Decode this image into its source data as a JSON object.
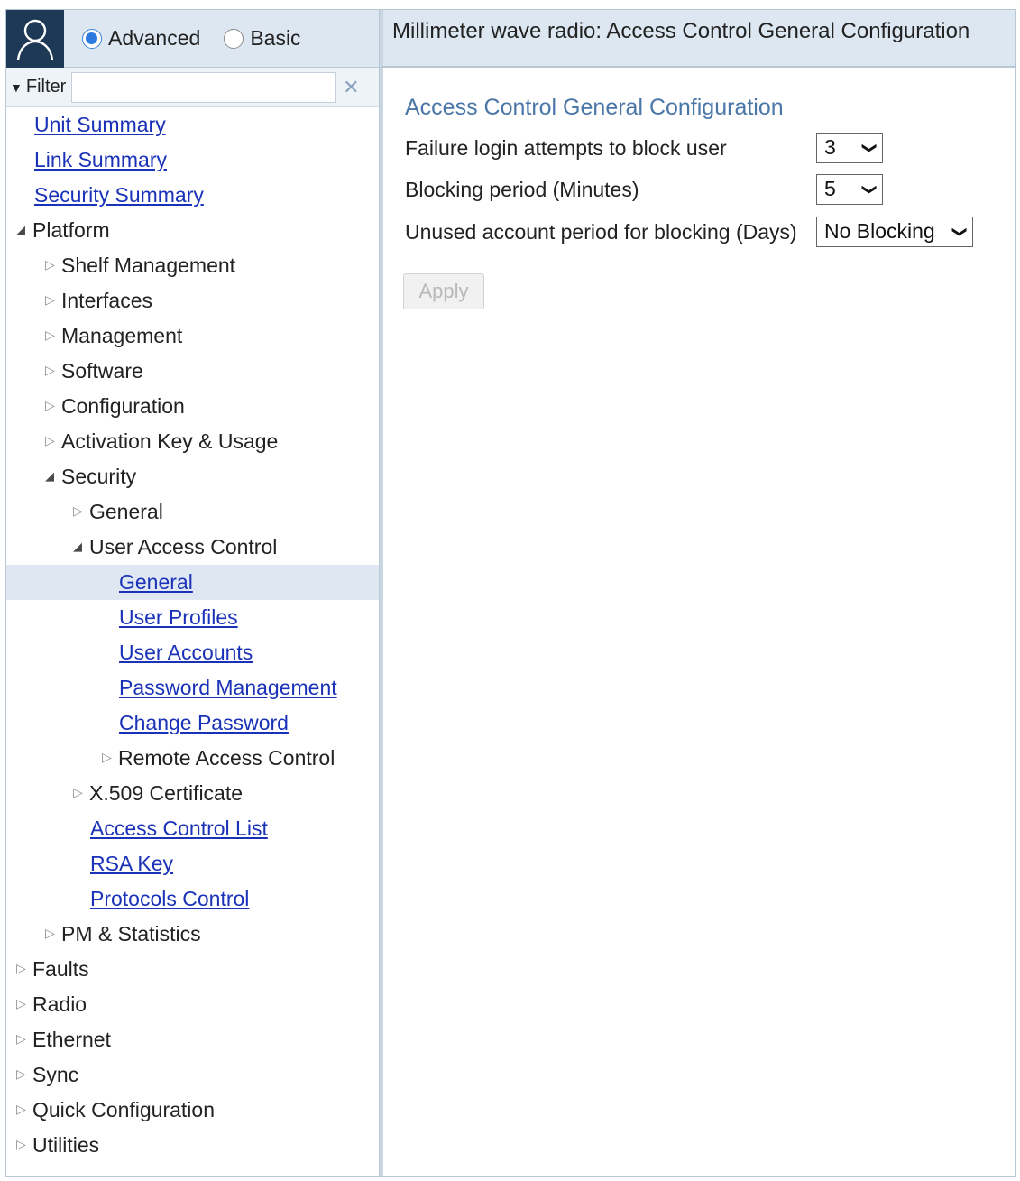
{
  "header": {
    "mode_options": [
      {
        "label": "Advanced",
        "selected": true
      },
      {
        "label": "Basic",
        "selected": false
      }
    ],
    "filter_label": "Filter",
    "filter_value": ""
  },
  "nav": {
    "unit_summary": "Unit Summary",
    "link_summary": "Link Summary",
    "security_summary": "Security Summary",
    "platform": "Platform",
    "shelf_management": "Shelf Management",
    "interfaces": "Interfaces",
    "management": "Management",
    "software": "Software",
    "configuration": "Configuration",
    "activation_key": "Activation Key & Usage",
    "security": "Security",
    "general": "General",
    "user_access_control": "User Access Control",
    "uac_general": "General",
    "user_profiles": "User Profiles",
    "user_accounts": "User Accounts",
    "password_management": "Password Management",
    "change_password": "Change Password",
    "remote_access_control": "Remote Access Control",
    "x509": "X.509 Certificate",
    "access_control_list": "Access Control List",
    "rsa_key": "RSA Key",
    "protocols_control": "Protocols Control",
    "pm_statistics": "PM & Statistics",
    "faults": "Faults",
    "radio": "Radio",
    "ethernet": "Ethernet",
    "sync": "Sync",
    "quick_configuration": "Quick Configuration",
    "utilities": "Utilities"
  },
  "main": {
    "page_title": "Millimeter wave radio: Access Control General Configuration",
    "section_title": "Access Control General Configuration",
    "failure_login_label": "Failure login attempts to block user",
    "failure_login_value": "3",
    "blocking_period_label": "Blocking period (Minutes)",
    "blocking_period_value": "5",
    "unused_account_label": "Unused account period for blocking (Days)",
    "unused_account_value": "No Blocking",
    "apply_label": "Apply"
  },
  "colors": {
    "header_bg": "#dde7f1",
    "avatar_bg": "#1e3956",
    "link": "#1a32b8",
    "section_title": "#4a76a8",
    "selected_row": "#dfe8f2"
  }
}
